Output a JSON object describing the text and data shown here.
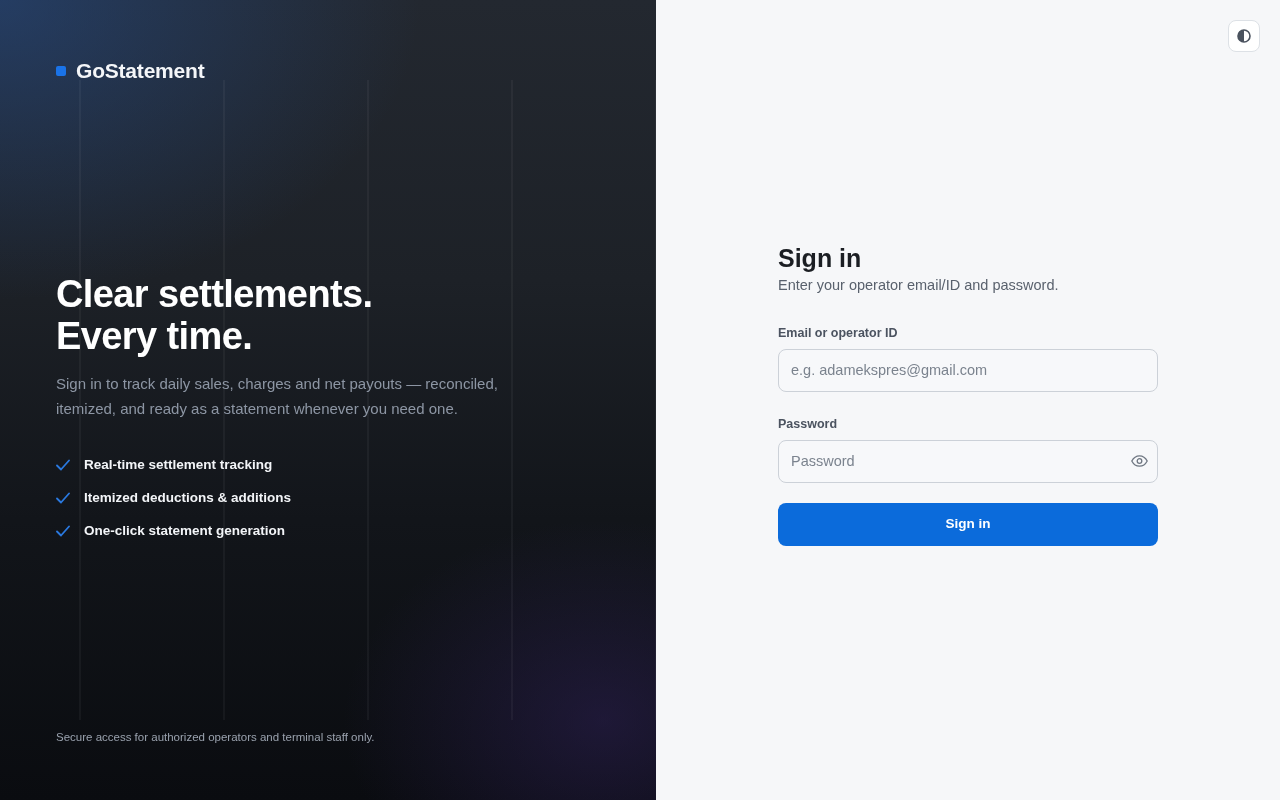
{
  "brand": {
    "name": "GoStatement"
  },
  "hero": {
    "headline_lines": [
      "Clear settlements.",
      "Every time."
    ],
    "description": "Sign in to track daily sales, charges and net payouts — reconciled, itemized, and ready as a statement whenever you need one.",
    "features": [
      "Real-time settlement tracking",
      "Itemized deductions & additions",
      "One-click statement generation"
    ],
    "footer_note": "Secure access for authorized operators and terminal staff only."
  },
  "form": {
    "title": "Sign in",
    "subtitle": "Enter your operator email/ID and password.",
    "fields": [
      {
        "kind": "text",
        "label": "Email or operator ID",
        "placeholder": "e.g. adamekspres@gmail.com"
      },
      {
        "kind": "password",
        "label": "Password",
        "placeholder": "Password"
      }
    ],
    "submit": "Sign in"
  }
}
